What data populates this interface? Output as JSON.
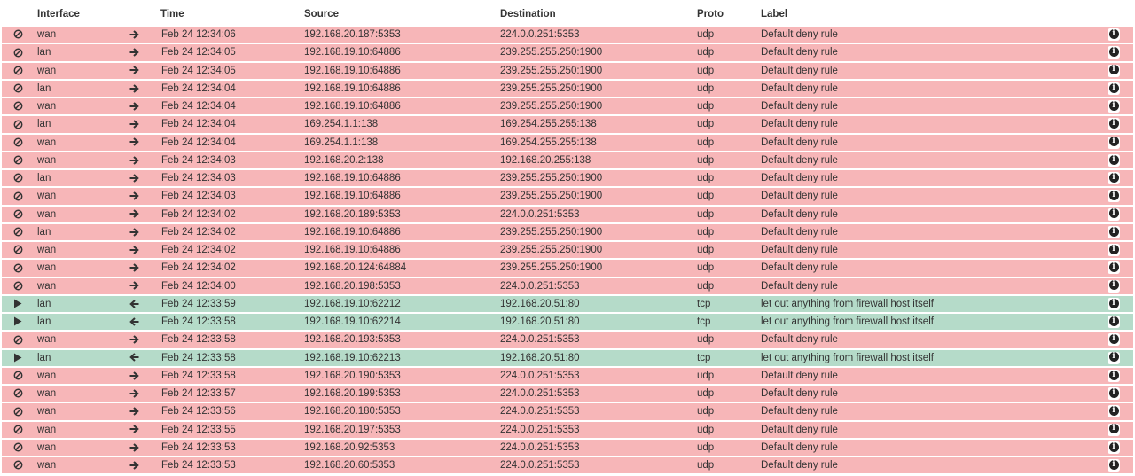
{
  "header": {
    "interface": "Interface",
    "time": "Time",
    "source": "Source",
    "destination": "Destination",
    "proto": "Proto",
    "label": "Label"
  },
  "colors": {
    "block_row": "#f7b6b8",
    "pass_row": "#b5dbc9"
  },
  "icons": {
    "block": "ban-icon",
    "pass": "play-icon",
    "in": "arrow-right-icon",
    "out": "arrow-left-icon",
    "info": "info-circle-icon"
  },
  "rows": [
    {
      "action": "block",
      "iface": "wan",
      "dir": "in",
      "time": "Feb 24 12:34:06",
      "src": "192.168.20.187:5353",
      "dst": "224.0.0.251:5353",
      "proto": "udp",
      "label": "Default deny rule"
    },
    {
      "action": "block",
      "iface": "lan",
      "dir": "in",
      "time": "Feb 24 12:34:05",
      "src": "192.168.19.10:64886",
      "dst": "239.255.255.250:1900",
      "proto": "udp",
      "label": "Default deny rule"
    },
    {
      "action": "block",
      "iface": "wan",
      "dir": "in",
      "time": "Feb 24 12:34:05",
      "src": "192.168.19.10:64886",
      "dst": "239.255.255.250:1900",
      "proto": "udp",
      "label": "Default deny rule"
    },
    {
      "action": "block",
      "iface": "lan",
      "dir": "in",
      "time": "Feb 24 12:34:04",
      "src": "192.168.19.10:64886",
      "dst": "239.255.255.250:1900",
      "proto": "udp",
      "label": "Default deny rule"
    },
    {
      "action": "block",
      "iface": "wan",
      "dir": "in",
      "time": "Feb 24 12:34:04",
      "src": "192.168.19.10:64886",
      "dst": "239.255.255.250:1900",
      "proto": "udp",
      "label": "Default deny rule"
    },
    {
      "action": "block",
      "iface": "lan",
      "dir": "in",
      "time": "Feb 24 12:34:04",
      "src": "169.254.1.1:138",
      "dst": "169.254.255.255:138",
      "proto": "udp",
      "label": "Default deny rule"
    },
    {
      "action": "block",
      "iface": "wan",
      "dir": "in",
      "time": "Feb 24 12:34:04",
      "src": "169.254.1.1:138",
      "dst": "169.254.255.255:138",
      "proto": "udp",
      "label": "Default deny rule"
    },
    {
      "action": "block",
      "iface": "wan",
      "dir": "in",
      "time": "Feb 24 12:34:03",
      "src": "192.168.20.2:138",
      "dst": "192.168.20.255:138",
      "proto": "udp",
      "label": "Default deny rule"
    },
    {
      "action": "block",
      "iface": "lan",
      "dir": "in",
      "time": "Feb 24 12:34:03",
      "src": "192.168.19.10:64886",
      "dst": "239.255.255.250:1900",
      "proto": "udp",
      "label": "Default deny rule"
    },
    {
      "action": "block",
      "iface": "wan",
      "dir": "in",
      "time": "Feb 24 12:34:03",
      "src": "192.168.19.10:64886",
      "dst": "239.255.255.250:1900",
      "proto": "udp",
      "label": "Default deny rule"
    },
    {
      "action": "block",
      "iface": "wan",
      "dir": "in",
      "time": "Feb 24 12:34:02",
      "src": "192.168.20.189:5353",
      "dst": "224.0.0.251:5353",
      "proto": "udp",
      "label": "Default deny rule"
    },
    {
      "action": "block",
      "iface": "lan",
      "dir": "in",
      "time": "Feb 24 12:34:02",
      "src": "192.168.19.10:64886",
      "dst": "239.255.255.250:1900",
      "proto": "udp",
      "label": "Default deny rule"
    },
    {
      "action": "block",
      "iface": "wan",
      "dir": "in",
      "time": "Feb 24 12:34:02",
      "src": "192.168.19.10:64886",
      "dst": "239.255.255.250:1900",
      "proto": "udp",
      "label": "Default deny rule"
    },
    {
      "action": "block",
      "iface": "wan",
      "dir": "in",
      "time": "Feb 24 12:34:02",
      "src": "192.168.20.124:64884",
      "dst": "239.255.255.250:1900",
      "proto": "udp",
      "label": "Default deny rule"
    },
    {
      "action": "block",
      "iface": "wan",
      "dir": "in",
      "time": "Feb 24 12:34:00",
      "src": "192.168.20.198:5353",
      "dst": "224.0.0.251:5353",
      "proto": "udp",
      "label": "Default deny rule"
    },
    {
      "action": "pass",
      "iface": "lan",
      "dir": "out",
      "time": "Feb 24 12:33:59",
      "src": "192.168.19.10:62212",
      "dst": "192.168.20.51:80",
      "proto": "tcp",
      "label": "let out anything from firewall host itself"
    },
    {
      "action": "pass",
      "iface": "lan",
      "dir": "out",
      "time": "Feb 24 12:33:58",
      "src": "192.168.19.10:62214",
      "dst": "192.168.20.51:80",
      "proto": "tcp",
      "label": "let out anything from firewall host itself"
    },
    {
      "action": "block",
      "iface": "wan",
      "dir": "in",
      "time": "Feb 24 12:33:58",
      "src": "192.168.20.193:5353",
      "dst": "224.0.0.251:5353",
      "proto": "udp",
      "label": "Default deny rule"
    },
    {
      "action": "pass",
      "iface": "lan",
      "dir": "out",
      "time": "Feb 24 12:33:58",
      "src": "192.168.19.10:62213",
      "dst": "192.168.20.51:80",
      "proto": "tcp",
      "label": "let out anything from firewall host itself"
    },
    {
      "action": "block",
      "iface": "wan",
      "dir": "in",
      "time": "Feb 24 12:33:58",
      "src": "192.168.20.190:5353",
      "dst": "224.0.0.251:5353",
      "proto": "udp",
      "label": "Default deny rule"
    },
    {
      "action": "block",
      "iface": "wan",
      "dir": "in",
      "time": "Feb 24 12:33:57",
      "src": "192.168.20.199:5353",
      "dst": "224.0.0.251:5353",
      "proto": "udp",
      "label": "Default deny rule"
    },
    {
      "action": "block",
      "iface": "wan",
      "dir": "in",
      "time": "Feb 24 12:33:56",
      "src": "192.168.20.180:5353",
      "dst": "224.0.0.251:5353",
      "proto": "udp",
      "label": "Default deny rule"
    },
    {
      "action": "block",
      "iface": "wan",
      "dir": "in",
      "time": "Feb 24 12:33:55",
      "src": "192.168.20.197:5353",
      "dst": "224.0.0.251:5353",
      "proto": "udp",
      "label": "Default deny rule"
    },
    {
      "action": "block",
      "iface": "wan",
      "dir": "in",
      "time": "Feb 24 12:33:53",
      "src": "192.168.20.92:5353",
      "dst": "224.0.0.251:5353",
      "proto": "udp",
      "label": "Default deny rule"
    },
    {
      "action": "block",
      "iface": "wan",
      "dir": "in",
      "time": "Feb 24 12:33:53",
      "src": "192.168.20.60:5353",
      "dst": "224.0.0.251:5353",
      "proto": "udp",
      "label": "Default deny rule"
    }
  ]
}
